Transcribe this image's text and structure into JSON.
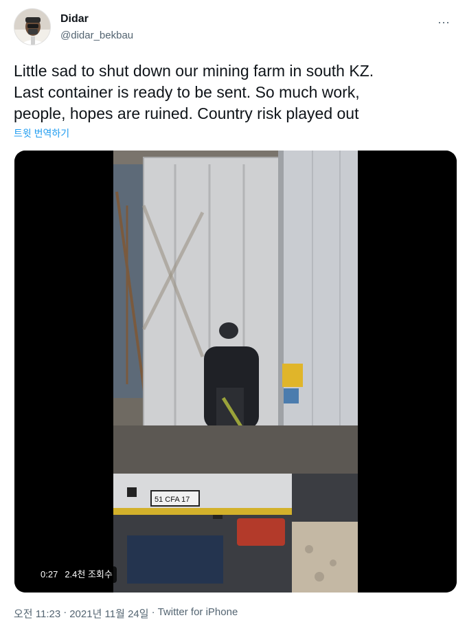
{
  "author": {
    "display_name": "Didar",
    "handle": "@didar_bekbau"
  },
  "more_label": "···",
  "tweet": {
    "text": "Little sad to shut down our mining farm in south KZ.\nLast container is ready to be sent. So much work,\npeople, hopes are ruined. Country risk played out",
    "translate_label": "트윗 번역하기"
  },
  "video": {
    "duration": "0:27",
    "views": "2.4천 조회수",
    "plate_text": "51 CFA 17"
  },
  "footer": {
    "time": "오전 11:23",
    "sep1": "·",
    "date": "2021년 11월 24일",
    "sep2": "·",
    "source": "Twitter for iPhone"
  },
  "colors": {
    "link": "#1d9bf0",
    "secondary_text": "#536471",
    "primary_text": "#0f1419"
  }
}
